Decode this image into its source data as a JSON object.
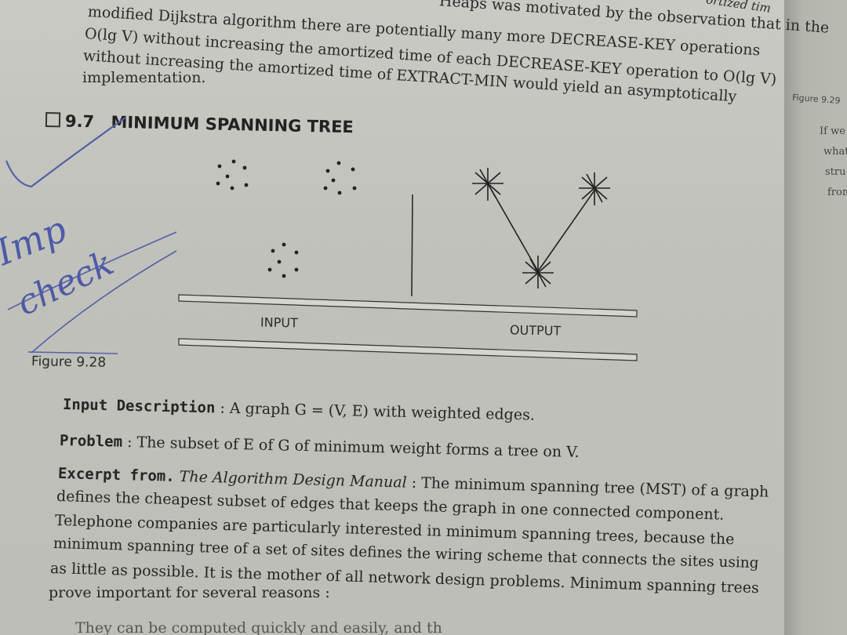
{
  "top_lines": [
    "Heaps was motivated by the observation that in the",
    "modified Dijkstra algorithm there are potentially many more DECREASE-KEY operations",
    "O(lg V) without increasing the amortized time of each DECREASE-KEY operation to O(lg V)",
    "without increasing the amortized time of EXTRACT-MIN would yield an asymptotically",
    "implementation."
  ],
  "top_corner": "ortized tim",
  "section": {
    "number": "9.7",
    "title": "MINIMUM SPANNING TREE"
  },
  "handwriting": {
    "line1": "Imp",
    "line2": "check"
  },
  "figure": {
    "label": "Figure 9.28",
    "input_label": "INPUT",
    "output_label": "OUTPUT"
  },
  "right_page": {
    "figure_ref": "Figure 9.29",
    "lines": [
      "If we",
      "what",
      "stru",
      "from"
    ]
  },
  "input_description": {
    "label": "Input Description",
    "sep": " : ",
    "text": "A graph G = (V, E) with weighted edges."
  },
  "problem": {
    "label": "Problem",
    "sep": " : ",
    "text": "The subset of E of G of minimum weight forms a tree on V."
  },
  "excerpt": {
    "label": "Excerpt from.",
    "source": "The Algorithm Design Manual",
    "sep": " : ",
    "first": "The minimum spanning tree (MST) of a graph",
    "lines": [
      "defines the cheapest subset of edges that keeps the graph in one connected component.",
      "Telephone companies are particularly interested in minimum spanning trees, because the",
      "minimum spanning tree of a set of sites defines the wiring scheme that connects the sites using",
      "as little as possible. It is the mother of all network design problems. Minimum spanning trees",
      "prove important for several reasons :"
    ]
  },
  "bottom_line": "They can be computed quickly and easily, and th"
}
